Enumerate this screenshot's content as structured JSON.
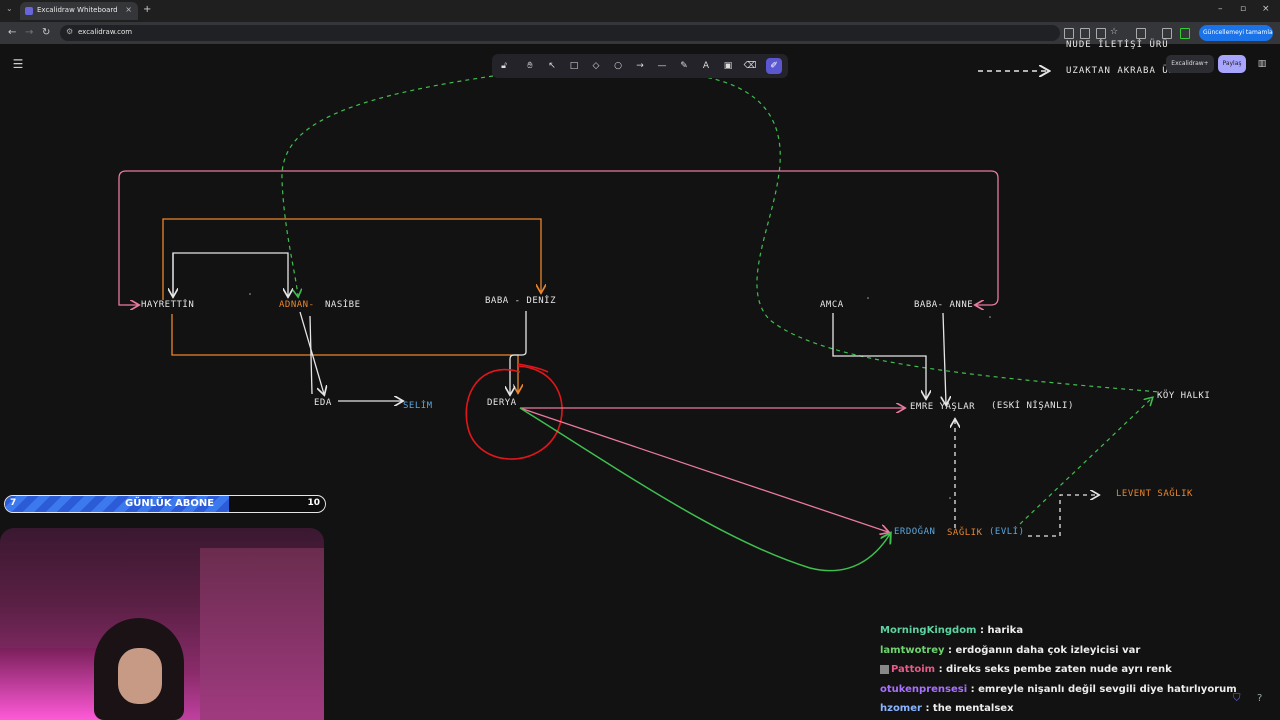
{
  "browser": {
    "tab_title": "Excalidraw Whiteboard",
    "tab_close": "×",
    "new_tab": "+",
    "url": "excalidraw.com",
    "update_button": "Güncellemeyi tamamla",
    "window_min": "–",
    "window_max": "▫",
    "window_close": "×"
  },
  "excalidraw": {
    "plus_label": "Excalidraw+",
    "share_label": "Paylaş",
    "tools": [
      "lock",
      "hand",
      "selection",
      "rectangle",
      "diamond",
      "ellipse",
      "arrow",
      "line",
      "draw",
      "text",
      "image",
      "eraser",
      "laser"
    ],
    "legend": {
      "top_partial": "NUDE İLETİŞİ ÜRÜ",
      "dashed_label": "UZAKTAN AKRABA ÜR"
    },
    "nodes": {
      "hayrettin": "HAYRETTİN",
      "adnan": "ADNAN-",
      "nasibe": "NASİBE",
      "baba_deniz": "BABA - DENİZ",
      "eda": "EDA",
      "selim": "SELİM",
      "derya": "DERYA",
      "amca": "AMCA",
      "baba_anne": "BABA- ANNE",
      "emre": "EMRE YAŞLAR",
      "eski": "(ESKİ NİŞANLI)",
      "koy": "KÖY HALKI",
      "levent": "LEVENT SAĞLIK",
      "erdogan": "ERDOĞAN",
      "saglik": "SAĞLIK",
      "evli": "(EVLİ)"
    }
  },
  "subgoal": {
    "label": "GÜNLÜK ABONE",
    "current": "7",
    "max": "10",
    "progress_fraction": 0.7
  },
  "chat": [
    {
      "user": "MorningKingdom",
      "color": "#5cd3a0",
      "message": ": harika"
    },
    {
      "user": "lamtwotrey",
      "color": "#6fd36f",
      "message": ": erdoğanın daha çok izleyicisi var"
    },
    {
      "user": "Pattoim",
      "color": "#e65a8a",
      "message": ": direks seks pembe zaten nude ayrı renk"
    },
    {
      "user": "otukenprensesi",
      "color": "#a970ff",
      "message": ": emreyle nişanlı değil sevgili diye hatırlıyorum"
    },
    {
      "user": "hzomer",
      "color": "#8ab4ff",
      "message": ": the mentalsex"
    }
  ],
  "colors": {
    "pink": "#e87a9e",
    "green": "#3fbf4f",
    "orange": "#e8862d",
    "red": "#e0161b",
    "white": "#e6e6e6",
    "accent": "#6965db"
  }
}
